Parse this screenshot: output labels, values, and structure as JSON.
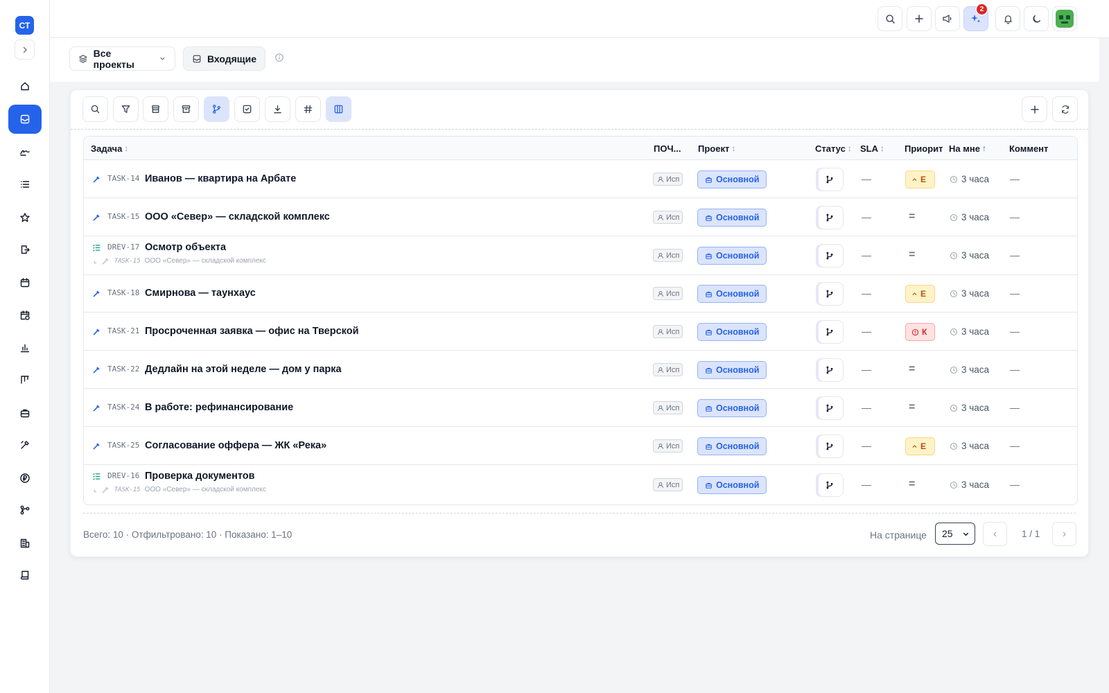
{
  "sidebar": {
    "logo": "СТ",
    "items": [
      {
        "icon": "home-icon"
      },
      {
        "icon": "inbox-icon",
        "active": true
      },
      {
        "icon": "signature-icon"
      },
      {
        "icon": "list-icon"
      },
      {
        "icon": "star-icon"
      },
      {
        "icon": "document-exit-icon"
      },
      {
        "icon": "calendar-icon"
      },
      {
        "icon": "calendar-clock-icon"
      },
      {
        "icon": "bar-chart-icon"
      },
      {
        "icon": "kanban-icon"
      },
      {
        "icon": "briefcase-icon"
      },
      {
        "icon": "tools-icon"
      },
      {
        "icon": "ruble-icon"
      },
      {
        "icon": "workflow-icon"
      },
      {
        "icon": "building-icon"
      },
      {
        "icon": "book-icon"
      }
    ]
  },
  "topbar": {
    "notification_badge": "2",
    "buttons": [
      "search-icon",
      "plus-icon",
      "announcement-icon",
      "sparkles-icon",
      "bell-icon",
      "moon-icon",
      "avatar"
    ]
  },
  "subheader": {
    "projects_label": "Все проекты",
    "inbox_label": "Входящие"
  },
  "toolbar": {
    "tools": [
      "search-icon",
      "filter-icon",
      "archive-box-icon",
      "archive-icon",
      "git-branch-icon",
      "checkbox-icon",
      "download-icon",
      "hash-icon",
      "columns-icon"
    ]
  },
  "table": {
    "columns": {
      "task": "Задача",
      "email": "ПОЧ...",
      "project": "Проект",
      "status": "Статус",
      "sla": "SLA",
      "priority": "Приорит",
      "mine": "На мне",
      "comments": "Коммент"
    },
    "rows": [
      {
        "type": "task",
        "key": "TASK-14",
        "title": "Иванов — квартира на Арбате",
        "assignee": "Исп",
        "project": "Основной",
        "sla": "—",
        "priority": "high",
        "priority_label": "Е",
        "mine": "3 часа",
        "comments": "—"
      },
      {
        "type": "task",
        "key": "TASK-15",
        "title": "ООО «Север» — складской комплекс",
        "assignee": "Исп",
        "project": "Основной",
        "sla": "—",
        "priority": "normal",
        "priority_label": "=",
        "mine": "3 часа",
        "comments": "—"
      },
      {
        "type": "subtask",
        "key": "DREV-17",
        "title": "Осмотр объекта",
        "parent_key": "TASK-15",
        "parent_title": "ООО «Север» — складской комплекс",
        "assignee": "Исп",
        "project": "Основной",
        "sla": "—",
        "priority": "normal",
        "priority_label": "=",
        "mine": "3 часа",
        "comments": "—"
      },
      {
        "type": "task",
        "key": "TASK-18",
        "title": "Смирнова — таунхаус",
        "assignee": "Исп",
        "project": "Основной",
        "sla": "—",
        "priority": "high",
        "priority_label": "Е",
        "mine": "3 часа",
        "comments": "—"
      },
      {
        "type": "task",
        "key": "TASK-21",
        "title": "Просроченная заявка — офис на Тверской",
        "assignee": "Исп",
        "project": "Основной",
        "sla": "—",
        "priority": "crit",
        "priority_label": "К",
        "mine": "3 часа",
        "comments": "—"
      },
      {
        "type": "task",
        "key": "TASK-22",
        "title": "Дедлайн на этой неделе — дом у парка",
        "assignee": "Исп",
        "project": "Основной",
        "sla": "—",
        "priority": "normal",
        "priority_label": "=",
        "mine": "3 часа",
        "comments": "—"
      },
      {
        "type": "task",
        "key": "TASK-24",
        "title": "В работе: рефинансирование",
        "assignee": "Исп",
        "project": "Основной",
        "sla": "—",
        "priority": "normal",
        "priority_label": "=",
        "mine": "3 часа",
        "comments": "—"
      },
      {
        "type": "task",
        "key": "TASK-25",
        "title": "Согласование оффера — ЖК «Река»",
        "assignee": "Исп",
        "project": "Основной",
        "sla": "—",
        "priority": "high",
        "priority_label": "Е",
        "mine": "3 часа",
        "comments": "—"
      },
      {
        "type": "subtask",
        "key": "DREV-16",
        "title": "Проверка документов",
        "parent_key": "TASK-15",
        "parent_title": "ООО «Север» — складской комплекс",
        "assignee": "Исп",
        "project": "Основной",
        "sla": "—",
        "priority": "normal",
        "priority_label": "=",
        "mine": "3 часа",
        "comments": "—"
      }
    ]
  },
  "footer": {
    "summary": "Всего: 10 · Отфильтровано: 10 · Показано: 1–10",
    "per_page_label": "На странице",
    "per_page_value": "25",
    "page_info": "1 / 1",
    "prev": "‹",
    "next": "›"
  },
  "colors": {
    "accent": "#2563eb",
    "priority_high": "#b45309",
    "priority_critical": "#dc2626"
  }
}
